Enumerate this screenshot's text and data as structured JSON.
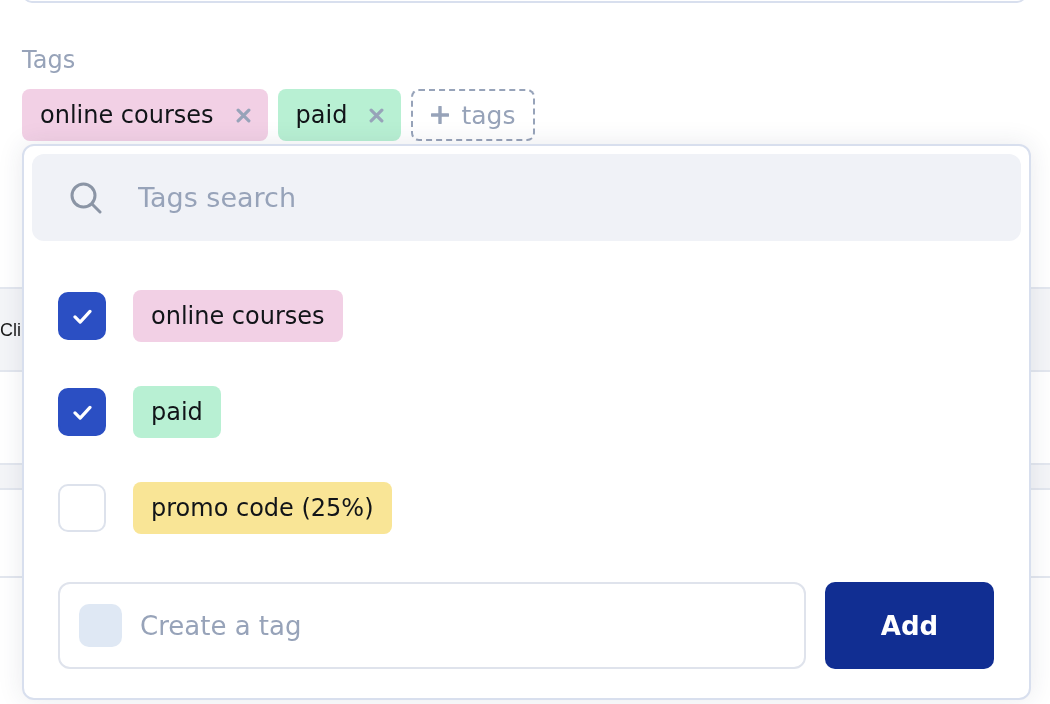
{
  "tags_field": {
    "label": "Tags",
    "tags": [
      {
        "label": "online courses",
        "color": "#f2d0e5"
      },
      {
        "label": "paid",
        "color": "#b8f0d3"
      }
    ],
    "add_button": "tags"
  },
  "table": {
    "columns": [
      "Cli"
    ]
  },
  "tag_picker": {
    "search": {
      "placeholder": "Tags search"
    },
    "options": [
      {
        "label": "online courses",
        "color": "#f2d0e5",
        "checked": true
      },
      {
        "label": "paid",
        "color": "#b8f0d3",
        "checked": true
      },
      {
        "label": "promo code (25%)",
        "color": "#f9e596",
        "checked": false
      }
    ],
    "new_tag": {
      "placeholder": "Create a tag"
    },
    "add_button": "Add"
  }
}
